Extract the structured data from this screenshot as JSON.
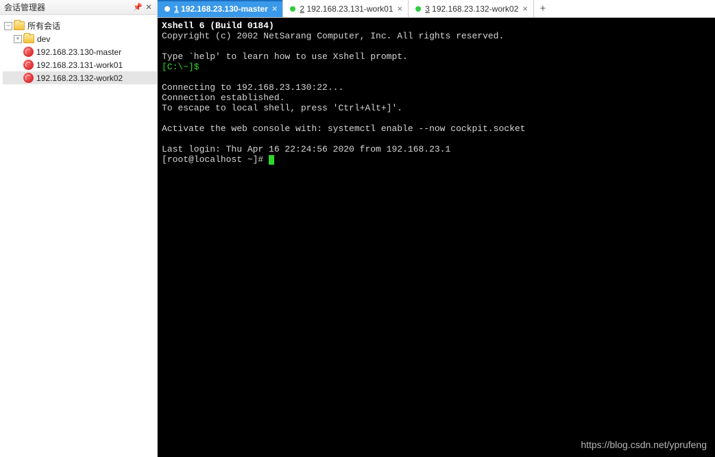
{
  "sidebar": {
    "title": "会话管理器",
    "root_label": "所有会话",
    "folder_label": "dev",
    "sessions": [
      "192.168.23.130-master",
      "192.168.23.131-work01",
      "192.168.23.132-work02"
    ]
  },
  "tabs": [
    {
      "num": "1",
      "label": "192.168.23.130-master",
      "active": true
    },
    {
      "num": "2",
      "label": "192.168.23.131-work01",
      "active": false
    },
    {
      "num": "3",
      "label": "192.168.23.132-work02",
      "active": false
    }
  ],
  "terminal": {
    "banner1": "Xshell 6 (Build 0184)",
    "banner2": "Copyright (c) 2002 NetSarang Computer, Inc. All rights reserved.",
    "help_line": "Type `help' to learn how to use Xshell prompt.",
    "local_prompt": "[C:\\~]$",
    "connecting": "Connecting to 192.168.23.130:22...",
    "established": "Connection established.",
    "escape": "To escape to local shell, press 'Ctrl+Alt+]'.",
    "activate": "Activate the web console with: systemctl enable --now cockpit.socket",
    "last_login": "Last login: Thu Apr 16 22:24:56 2020 from 192.168.23.1",
    "shell_prompt": "[root@localhost ~]# "
  },
  "watermark": "https://blog.csdn.net/yprufeng"
}
